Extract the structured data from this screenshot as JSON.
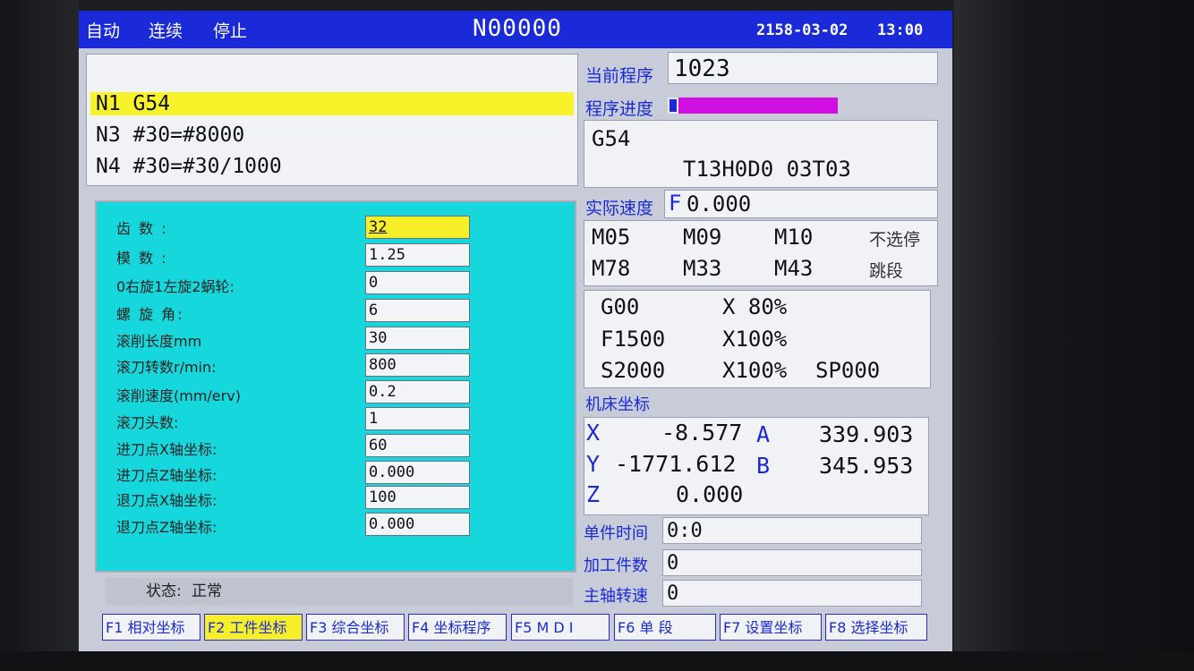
{
  "title": {
    "mode_auto": "自动",
    "mode_continuous": "连续",
    "mode_stop": "停止",
    "program": "N00000",
    "date": "2158-03-02",
    "time": "13:00"
  },
  "code_lines": [
    "N1 G54",
    "N3 #30=#8000",
    "N4 #30=#30/1000"
  ],
  "params": [
    {
      "label": "齿  数 :",
      "value": "32"
    },
    {
      "label": "模  数 :",
      "value": "1.25"
    },
    {
      "label": "0右旋1左旋2蜗轮:",
      "value": "0"
    },
    {
      "label": "螺 旋 角:",
      "value": "6"
    },
    {
      "label": "滚削长度mm",
      "value": "30"
    },
    {
      "label": "滚刀转数r/min:",
      "value": "800"
    },
    {
      "label": "滚削速度(mm/erv)",
      "value": "0.2"
    },
    {
      "label": "滚刀头数:",
      "value": "1"
    },
    {
      "label": "进刀点X轴坐标:",
      "value": "60"
    },
    {
      "label": "进刀点Z轴坐标:",
      "value": "0.000"
    },
    {
      "label": "退刀点X轴坐标:",
      "value": "100"
    },
    {
      "label": "退刀点Z轴坐标:",
      "value": "0.000"
    }
  ],
  "status": {
    "label": "状态:",
    "value": "正常"
  },
  "right": {
    "current_program_label": "当前程序",
    "current_program": "1023",
    "progress_label": "程序进度",
    "progress_fraction": 0.05,
    "modal_line1": "G54",
    "modal_line2": "T13H0D0 03T03",
    "actual_speed_label": "实际速度",
    "actual_speed_prefix": "F",
    "actual_speed": "0.000",
    "m_codes": [
      "M05",
      "M09",
      "M10",
      "不选停",
      "M78",
      "M33",
      "M43",
      "跳段"
    ],
    "g00": "G00",
    "x80": "X 80%",
    "f1500": "F1500",
    "x100a": "X100%",
    "s2000": "S2000",
    "x100b": "X100%",
    "sp": "SP000",
    "machine_coord_label": "机床坐标",
    "axes": {
      "X": "-8.577",
      "A": "339.903",
      "Y": "-1771.612",
      "B": "345.953",
      "Z": "0.000"
    },
    "axis_names": {
      "x": "X",
      "a": "A",
      "y": "Y",
      "b": "B",
      "z": "Z"
    },
    "piece_time_label": "单件时间",
    "piece_time": "0:0",
    "piece_count_label": "加工件数",
    "piece_count": "0",
    "spindle_label": "主轴转速",
    "spindle": "0"
  },
  "fkeys": [
    {
      "key": "F1",
      "label": "相对坐标"
    },
    {
      "key": "F2",
      "label": "工件坐标"
    },
    {
      "key": "F3",
      "label": "综合坐标"
    },
    {
      "key": "F4",
      "label": "坐标程序"
    },
    {
      "key": "F5",
      "label": "M D I"
    },
    {
      "key": "F6",
      "label": "单 段"
    },
    {
      "key": "F7",
      "label": "设置坐标"
    },
    {
      "key": "F8",
      "label": "选择坐标"
    }
  ],
  "colors": {
    "title_bar": "#1a2ad8",
    "highlight": "#f8f22a",
    "param_panel": "#16d8dc",
    "progress": "#d010e0"
  }
}
